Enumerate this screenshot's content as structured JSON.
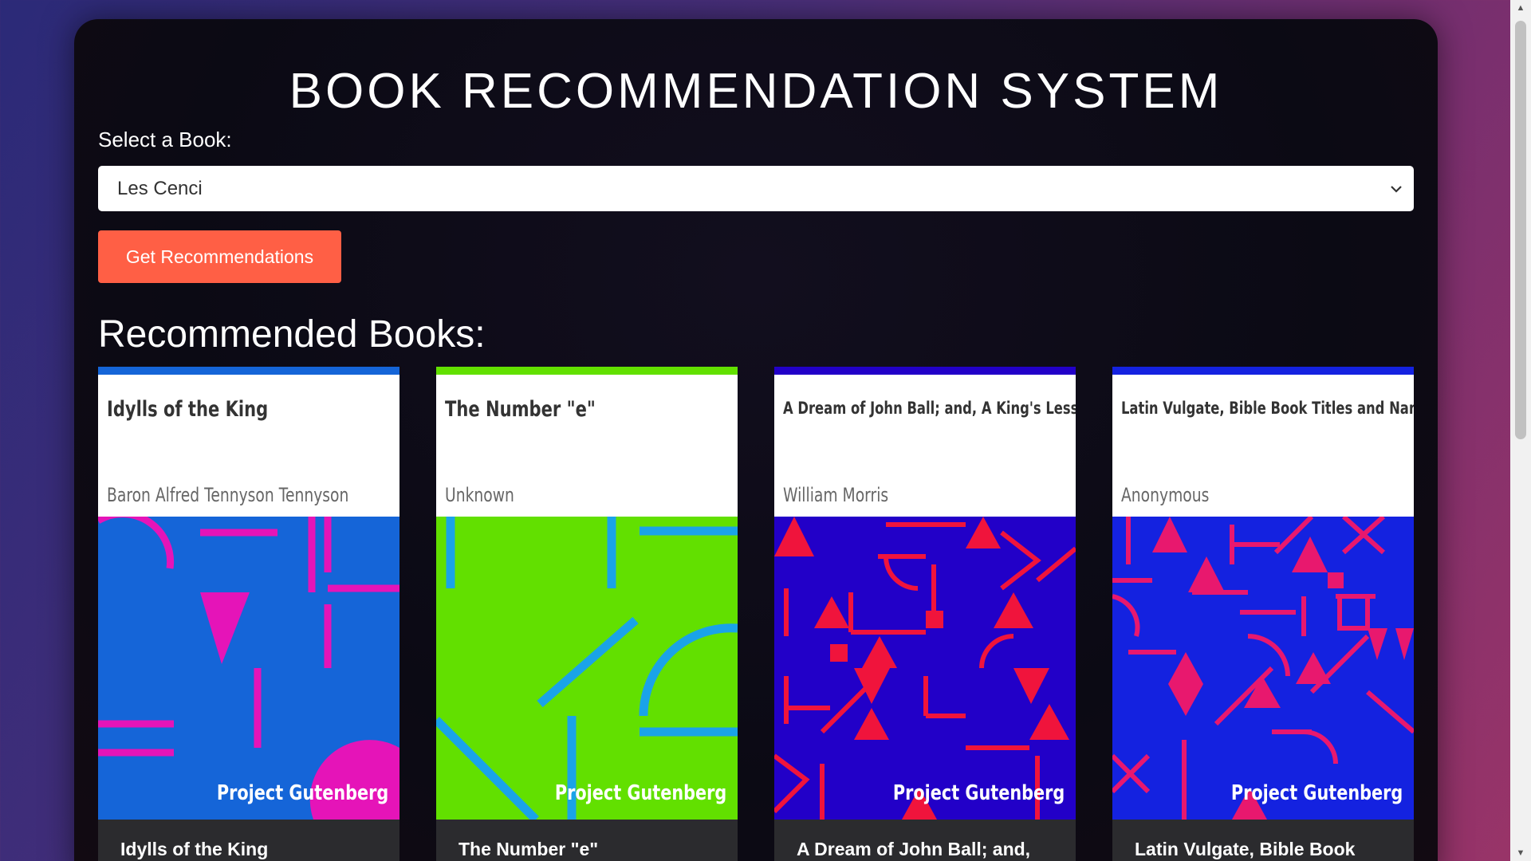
{
  "header": {
    "title": "BOOK RECOMMENDATION SYSTEM"
  },
  "selector": {
    "label": "Select a Book:",
    "selected_value": "Les Cenci"
  },
  "actions": {
    "recommend_label": "Get Recommendations"
  },
  "results": {
    "heading": "Recommended Books:",
    "books": [
      {
        "cover_title": "Idylls of the King",
        "cover_author": "Baron Alfred Tennyson Tennyson",
        "publisher": "Project Gutenberg",
        "card_title": "Idylls of the King",
        "colors": {
          "bg": "#1565d8",
          "accent": "#e514b8",
          "band": "#1565d8"
        }
      },
      {
        "cover_title": "The Number \"e\"",
        "cover_author": "Unknown",
        "publisher": "Project Gutenberg",
        "card_title": "The Number \"e\"",
        "colors": {
          "bg": "#62e000",
          "accent": "#1aa3e8",
          "band": "#62e000"
        }
      },
      {
        "cover_title": "A Dream of John Ball; and, A King's Lesson",
        "cover_author": "William Morris",
        "publisher": "Project Gutenberg",
        "card_title": "A Dream of John Ball; and,",
        "colors": {
          "bg": "#2200c8",
          "accent": "#f0143c",
          "band": "#2200c8"
        }
      },
      {
        "cover_title": "Latin Vulgate, Bible Book Titles and Names",
        "cover_author": "Anonymous",
        "publisher": "Project Gutenberg",
        "card_title": "Latin Vulgate, Bible Book",
        "colors": {
          "bg": "#1422e0",
          "accent": "#e8186e",
          "band": "#1422e0"
        }
      }
    ]
  }
}
